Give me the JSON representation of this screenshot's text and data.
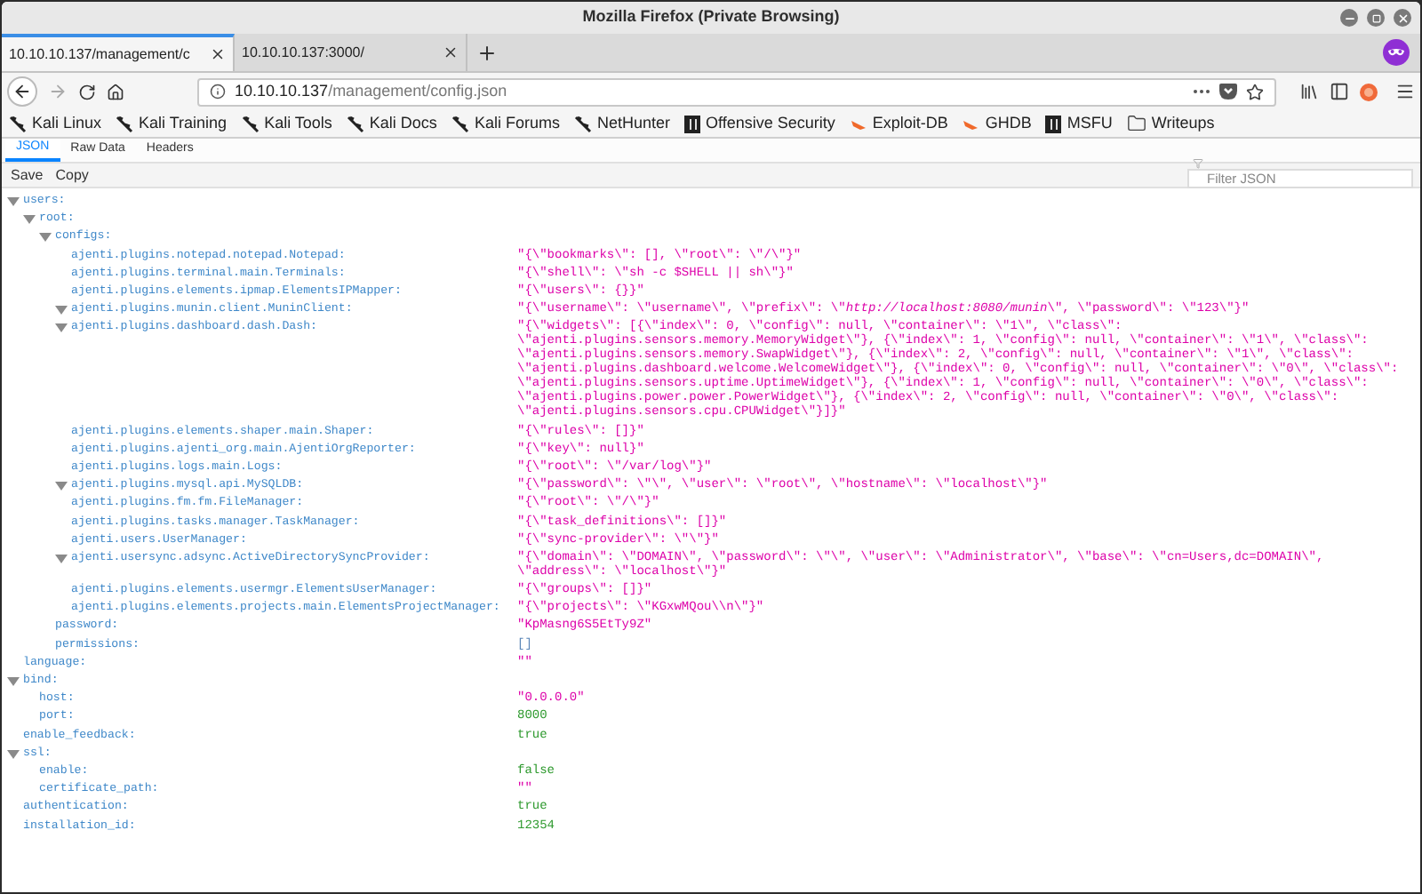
{
  "window": {
    "title": "Mozilla Firefox (Private Browsing)"
  },
  "tabs": [
    {
      "title": "10.10.10.137/management/c",
      "selected": true
    },
    {
      "title": "10.10.10.137:3000/",
      "selected": false
    }
  ],
  "address_bar": {
    "host": "10.10.10.137",
    "path": "/management/config.json"
  },
  "bookmarks": [
    {
      "label": "Kali Linux",
      "kind": "kali"
    },
    {
      "label": "Kali Training",
      "kind": "kali"
    },
    {
      "label": "Kali Tools",
      "kind": "kali"
    },
    {
      "label": "Kali Docs",
      "kind": "kali"
    },
    {
      "label": "Kali Forums",
      "kind": "kali"
    },
    {
      "label": "NetHunter",
      "kind": "kali"
    },
    {
      "label": "Offensive Security",
      "kind": "offsec"
    },
    {
      "label": "Exploit-DB",
      "kind": "exploit"
    },
    {
      "label": "GHDB",
      "kind": "exploit"
    },
    {
      "label": "MSFU",
      "kind": "offsec"
    },
    {
      "label": "Writeups",
      "kind": "folder"
    }
  ],
  "viewer_tabs": [
    {
      "label": "JSON",
      "selected": true
    },
    {
      "label": "Raw Data",
      "selected": false
    },
    {
      "label": "Headers",
      "selected": false
    }
  ],
  "toolbar": {
    "buttons": [
      "Save",
      "Copy"
    ],
    "filter": {
      "placeholder": "Filter JSON"
    }
  },
  "tree": [
    {
      "key": "users:",
      "expanded": true,
      "children": [
        {
          "key": "root:",
          "expanded": true,
          "children": [
            {
              "key": "configs:",
              "expanded": true,
              "children": [
                {
                  "key": "ajenti.plugins.notepad.notepad.Notepad:",
                  "kind": "string",
                  "value": "\"{\\\"bookmarks\\\": [], \\\"root\\\": \\\"/\\\"}\""
                },
                {
                  "key": "ajenti.plugins.terminal.main.Terminals:",
                  "kind": "string",
                  "value": "\"{\\\"shell\\\": \\\"sh -c $SHELL || sh\\\"}\""
                },
                {
                  "key": "ajenti.plugins.elements.ipmap.ElementsIPMapper:",
                  "kind": "string",
                  "value": "\"{\\\"users\\\": {}}\""
                },
                {
                  "key": "ajenti.plugins.munin.client.MuninClient:",
                  "expanded": true,
                  "kind": "string",
                  "value": "\"{\\\"username\\\": \\\"username\\\", \\\"prefix\\\": \\\"*http://localhost:8080/munin*\\\", \\\"password\\\": \\\"123\\\"}\""
                },
                {
                  "key": "ajenti.plugins.dashboard.dash.Dash:",
                  "expanded": true,
                  "kind": "string",
                  "value": "\"{\\\"widgets\\\": [{\\\"index\\\": 0, \\\"config\\\": null, \\\"container\\\": \\\"1\\\", \\\"class\\\": \\\"ajenti.plugins.sensors.memory.MemoryWidget\\\"}, {\\\"index\\\": 1, \\\"config\\\": null, \\\"container\\\": \\\"1\\\", \\\"class\\\": \\\"ajenti.plugins.sensors.memory.SwapWidget\\\"}, {\\\"index\\\": 2, \\\"config\\\": null, \\\"container\\\": \\\"1\\\", \\\"class\\\": \\\"ajenti.plugins.dashboard.welcome.WelcomeWidget\\\"}, {\\\"index\\\": 0, \\\"config\\\": null, \\\"container\\\": \\\"0\\\", \\\"class\\\": \\\"ajenti.plugins.sensors.uptime.UptimeWidget\\\"}, {\\\"index\\\": 1, \\\"config\\\": null, \\\"container\\\": \\\"0\\\", \\\"class\\\": \\\"ajenti.plugins.power.power.PowerWidget\\\"}, {\\\"index\\\": 2, \\\"config\\\": null, \\\"container\\\": \\\"0\\\", \\\"class\\\": \\\"ajenti.plugins.sensors.cpu.CPUWidget\\\"}]}\""
                },
                {
                  "key": "ajenti.plugins.elements.shaper.main.Shaper:",
                  "kind": "string",
                  "value": "\"{\\\"rules\\\": []}\""
                },
                {
                  "key": "ajenti.plugins.ajenti_org.main.AjentiOrgReporter:",
                  "kind": "string",
                  "value": "\"{\\\"key\\\": null}\""
                },
                {
                  "key": "ajenti.plugins.logs.main.Logs:",
                  "kind": "string",
                  "value": "\"{\\\"root\\\": \\\"/var/log\\\"}\""
                },
                {
                  "key": "ajenti.plugins.mysql.api.MySQLDB:",
                  "expanded": true,
                  "kind": "string",
                  "value": "\"{\\\"password\\\": \\\"\\\", \\\"user\\\": \\\"root\\\", \\\"hostname\\\": \\\"localhost\\\"}\""
                },
                {
                  "key": "ajenti.plugins.fm.fm.FileManager:",
                  "kind": "string",
                  "value": "\"{\\\"root\\\": \\\"/\\\"}\""
                },
                {
                  "key": "ajenti.plugins.tasks.manager.TaskManager:",
                  "kind": "string",
                  "value": "\"{\\\"task_definitions\\\": []}\""
                },
                {
                  "key": "ajenti.users.UserManager:",
                  "kind": "string",
                  "value": "\"{\\\"sync-provider\\\": \\\"\\\"}\""
                },
                {
                  "key": "ajenti.usersync.adsync.ActiveDirectorySyncProvider:",
                  "expanded": true,
                  "kind": "string",
                  "value": "\"{\\\"domain\\\": \\\"DOMAIN\\\", \\\"password\\\": \\\"\\\", \\\"user\\\": \\\"Administrator\\\", \\\"base\\\": \\\"cn=Users,dc=DOMAIN\\\", \\\"address\\\": \\\"localhost\\\"}\""
                },
                {
                  "key": "ajenti.plugins.elements.usermgr.ElementsUserManager:",
                  "kind": "string",
                  "value": "\"{\\\"groups\\\": []}\""
                },
                {
                  "key": "ajenti.plugins.elements.projects.main.ElementsProjectManager:",
                  "kind": "string",
                  "value": "\"{\\\"projects\\\": \\\"KGxwMQou\\\\n\\\"}\""
                }
              ]
            },
            {
              "key": "password:",
              "kind": "string",
              "value": "\"KpMasng6S5EtTy9Z\""
            },
            {
              "key": "permissions:",
              "kind": "array",
              "value": "[]"
            }
          ]
        }
      ]
    },
    {
      "key": "language:",
      "kind": "string",
      "value": "\"\""
    },
    {
      "key": "bind:",
      "expanded": true,
      "children": [
        {
          "key": "host:",
          "kind": "string",
          "value": "\"0.0.0.0\""
        },
        {
          "key": "port:",
          "kind": "number",
          "value": "8000"
        }
      ]
    },
    {
      "key": "enable_feedback:",
      "kind": "boolean",
      "value": "true"
    },
    {
      "key": "ssl:",
      "expanded": true,
      "children": [
        {
          "key": "enable:",
          "kind": "boolean",
          "value": "false"
        },
        {
          "key": "certificate_path:",
          "kind": "string",
          "value": "\"\""
        }
      ]
    },
    {
      "key": "authentication:",
      "kind": "boolean",
      "value": "true"
    },
    {
      "key": "installation_id:",
      "kind": "number",
      "value": "12354"
    }
  ]
}
